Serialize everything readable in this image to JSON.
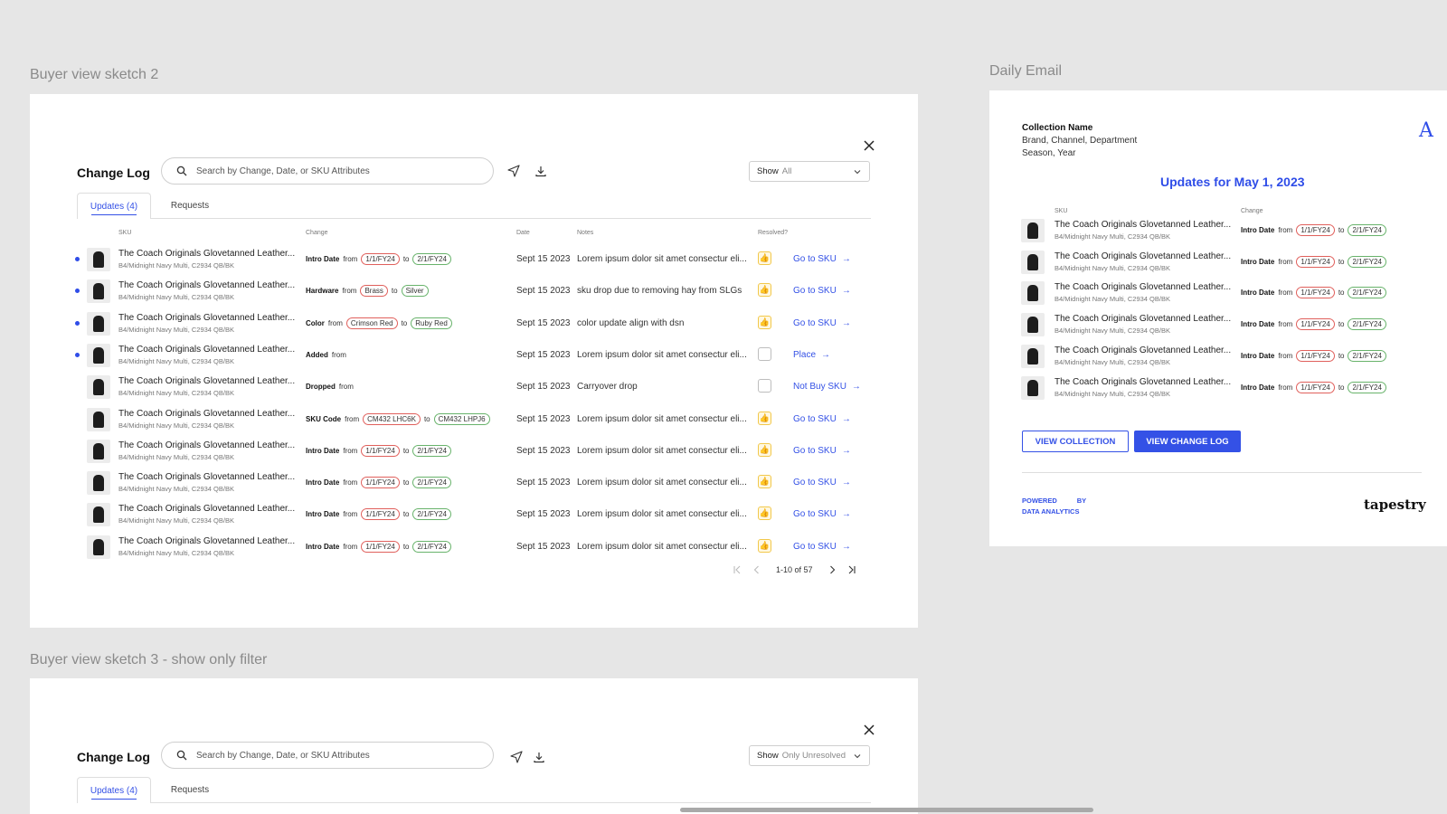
{
  "frames": {
    "sketch2_label": "Buyer view sketch 2",
    "email_label": "Daily Email",
    "sketch3_label": "Buyer view sketch 3 - show only filter"
  },
  "change_log": {
    "title": "Change Log",
    "search_placeholder": "Search by Change, Date, or SKU Attributes",
    "show_label": "Show",
    "show_value": "All",
    "tabs": [
      "Updates (4)",
      "Requests"
    ],
    "columns": {
      "sku": "SKU",
      "change": "Change",
      "date": "Date",
      "notes": "Notes",
      "resolved": "Resolved?"
    },
    "rows": [
      {
        "name": "The Coach Originals Glovetanned Leather...",
        "sub": "B4/Midnight Navy Multi, C2934 QB/BK",
        "change_label": "Intro Date",
        "word1": "from",
        "from": "1/1/FY24",
        "word2": "to",
        "to": "2/1/FY24",
        "date": "Sept 15 2023",
        "note": "Lorem ipsum dolor sit amet consectur eli...",
        "action": "Go to SKU"
      },
      {
        "name": "The Coach Originals Glovetanned Leather...",
        "sub": "B4/Midnight Navy Multi, C2934 QB/BK",
        "change_label": "Hardware",
        "word1": "from",
        "from": "Brass",
        "word2": "to",
        "to": "Silver",
        "date": "Sept 15 2023",
        "note": "sku drop due to removing hay from SLGs",
        "action": "Go to SKU"
      },
      {
        "name": "The Coach Originals Glovetanned Leather...",
        "sub": "B4/Midnight Navy Multi, C2934 QB/BK",
        "change_label": "Color",
        "word1": "from",
        "from": "Crimson Red",
        "word2": "to",
        "to": "Ruby Red",
        "date": "Sept 15 2023",
        "note": "color update align with dsn",
        "action": "Go to SKU"
      },
      {
        "name": "The Coach Originals Glovetanned Leather...",
        "sub": "B4/Midnight Navy Multi, C2934 QB/BK",
        "change_label": "Added",
        "word1": "from",
        "from": "",
        "word2": "",
        "to": "",
        "date": "Sept 15 2023",
        "note": "Lorem ipsum dolor sit amet consectur eli...",
        "action": "Place"
      },
      {
        "name": "The Coach Originals Glovetanned Leather...",
        "sub": "B4/Midnight Navy Multi, C2934 QB/BK",
        "change_label": "Dropped",
        "word1": "from",
        "from": "",
        "word2": "",
        "to": "",
        "date": "Sept 15 2023",
        "note": "Carryover drop",
        "action": "Not Buy SKU"
      },
      {
        "name": "The Coach Originals Glovetanned Leather...",
        "sub": "B4/Midnight Navy Multi, C2934 QB/BK",
        "change_label": "SKU Code",
        "word1": "from",
        "from": "CM432 LHC6K",
        "word2": "to",
        "to": "CM432 LHPJ6",
        "date": "Sept 15 2023",
        "note": "Lorem ipsum dolor sit amet consectur eli...",
        "action": "Go to SKU"
      },
      {
        "name": "The Coach Originals Glovetanned Leather...",
        "sub": "B4/Midnight Navy Multi, C2934 QB/BK",
        "change_label": "Intro Date",
        "word1": "from",
        "from": "1/1/FY24",
        "word2": "to",
        "to": "2/1/FY24",
        "date": "Sept 15 2023",
        "note": "Lorem ipsum dolor sit amet consectur eli...",
        "action": "Go to SKU"
      },
      {
        "name": "The Coach Originals Glovetanned Leather...",
        "sub": "B4/Midnight Navy Multi, C2934 QB/BK",
        "change_label": "Intro Date",
        "word1": "from",
        "from": "1/1/FY24",
        "word2": "to",
        "to": "2/1/FY24",
        "date": "Sept 15 2023",
        "note": "Lorem ipsum dolor sit amet consectur eli...",
        "action": "Go to SKU"
      },
      {
        "name": "The Coach Originals Glovetanned Leather...",
        "sub": "B4/Midnight Navy Multi, C2934 QB/BK",
        "change_label": "Intro Date",
        "word1": "from",
        "from": "1/1/FY24",
        "word2": "to",
        "to": "2/1/FY24",
        "date": "Sept 15 2023",
        "note": "Lorem ipsum dolor sit amet consectur eli...",
        "action": "Go to SKU"
      },
      {
        "name": "The Coach Originals Glovetanned Leather...",
        "sub": "B4/Midnight Navy Multi, C2934 QB/BK",
        "change_label": "Intro Date",
        "word1": "from",
        "from": "1/1/FY24",
        "word2": "to",
        "to": "2/1/FY24",
        "date": "Sept 15 2023",
        "note": "Lorem ipsum dolor sit amet consectur eli...",
        "action": "Go to SKU"
      }
    ],
    "unread": [
      true,
      true,
      true,
      true,
      false,
      false,
      false,
      false,
      false,
      false
    ],
    "resolved": [
      true,
      true,
      true,
      false,
      false,
      true,
      true,
      true,
      true,
      true
    ],
    "pagination": "1-10 of 57"
  },
  "change_log_2": {
    "title": "Change Log",
    "search_placeholder": "Search by Change, Date, or SKU Attributes",
    "show_label": "Show",
    "show_value": "Only Unresolved",
    "tabs": [
      "Updates (4)",
      "Requests"
    ]
  },
  "email": {
    "collection_name": "Collection Name",
    "line2": "Brand, Channel, Department",
    "line3": "Season, Year",
    "heading": "Updates for May 1, 2023",
    "col_sku": "SKU",
    "col_change": "Change",
    "row_count": 6,
    "row": {
      "name": "The Coach Originals Glovetanned Leather...",
      "sub": "B4/Midnight Navy Multi, C2934 QB/BK",
      "change_label": "Intro Date",
      "word1": "from",
      "from": "1/1/FY24",
      "word2": "to",
      "to": "2/1/FY24"
    },
    "btn_collection": "VIEW COLLECTION",
    "btn_changelog": "VIEW CHANGE LOG",
    "powered1": "POWERED",
    "powered2": "BY",
    "powered3": "DATA ANALYTICS",
    "brand": "tapestry",
    "corner_logo": "A"
  },
  "colors": {
    "accent": "#3451e6",
    "from_pill": "#e0605c",
    "to_pill": "#68b36b"
  }
}
